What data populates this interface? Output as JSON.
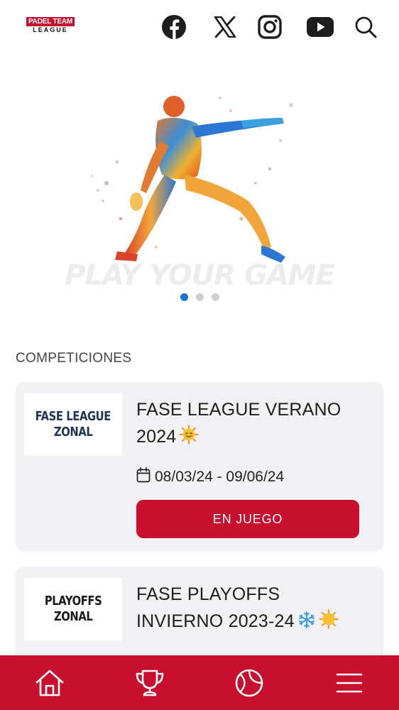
{
  "header": {
    "logo_top": "PADEL TEAM",
    "logo_bottom": "LEAGUE",
    "icons": [
      "facebook-icon",
      "x-icon",
      "instagram-icon",
      "youtube-icon",
      "search-icon"
    ]
  },
  "carousel": {
    "tagline": "PLAY YOUR GAME",
    "slide_count": 3,
    "active_slide": 1
  },
  "competitions": {
    "section_title": "COMPETICIONES",
    "cards": [
      {
        "logo_line1": "FASE LEAGUE",
        "logo_line2": "ZONAL",
        "title": "FASE LEAGUE VERANO 2024",
        "emoji": [
          "sun-smiling-icon"
        ],
        "dates": "08/03/24 - 09/06/24",
        "status": "EN JUEGO"
      },
      {
        "logo_line1": "PLAYOFFS",
        "logo_line2": "ZONAL",
        "title": "FASE PLAYOFFS INVIERNO 2023-24",
        "emoji": [
          "snowflake-icon",
          "sun-icon"
        ]
      }
    ]
  },
  "bottom_nav": {
    "items": [
      "home-icon",
      "trophy-icon",
      "tennis-ball-icon",
      "menu-icon"
    ]
  },
  "colors": {
    "brand_red": "#c8102e",
    "active_dot": "#1976d2",
    "card_bg": "#f1f0f2"
  }
}
